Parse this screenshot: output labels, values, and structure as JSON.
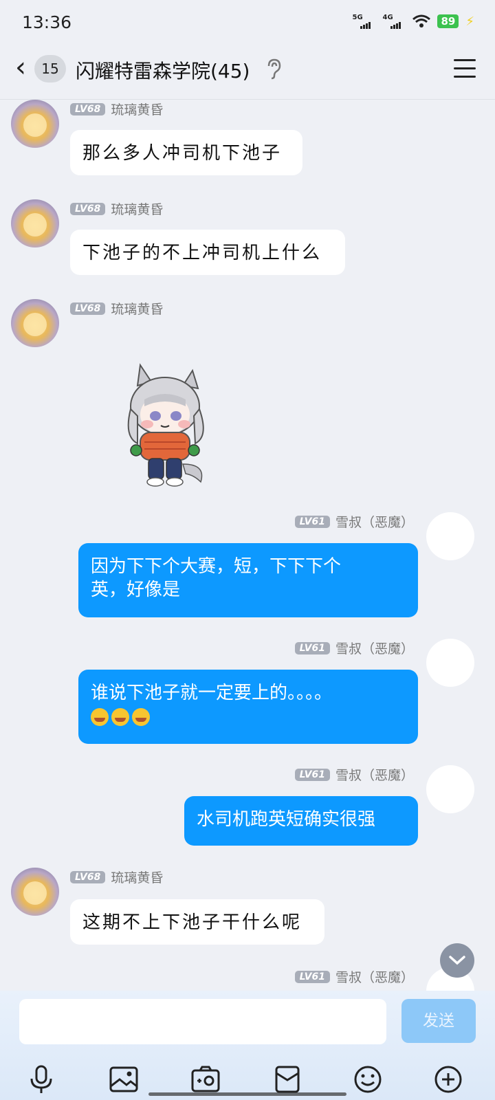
{
  "status_bar": {
    "time": "13:36",
    "signal_1": "5G",
    "signal_2": "4G",
    "battery": "89"
  },
  "header": {
    "unread_count": "15",
    "title": "闪耀特雷森学院(45)"
  },
  "messages": [
    {
      "side": "left",
      "level": "LV68",
      "sender": "琉璃黄昏",
      "text": "那么多人冲司机下池子"
    },
    {
      "side": "left",
      "level": "LV68",
      "sender": "琉璃黄昏",
      "text": "下池子的不上冲司机上什么"
    },
    {
      "side": "left",
      "level": "LV68",
      "sender": "琉璃黄昏",
      "sticker": "chibi-horse-girl-sticker"
    },
    {
      "side": "right",
      "level": "LV61",
      "sender": "雪叔（恶魔）",
      "line1": "因为下下个大赛，短，下下下个",
      "line2": "英，好像是"
    },
    {
      "side": "right",
      "level": "LV61",
      "sender": "雪叔（恶魔）",
      "text": "谁说下池子就一定要上的。。。。",
      "emojis": [
        "laugh-cry-emoji",
        "laugh-cry-emoji",
        "laugh-cry-emoji"
      ]
    },
    {
      "side": "right",
      "level": "LV61",
      "sender": "雪叔（恶魔）",
      "text": "水司机跑英短确实很强"
    },
    {
      "side": "left",
      "level": "LV68",
      "sender": "琉璃黄昏",
      "text": "这期不上下池子干什么呢"
    },
    {
      "side": "right",
      "level": "LV61",
      "sender": "雪叔（恶魔）"
    }
  ],
  "input": {
    "value": "",
    "send_label": "发送"
  },
  "toolbar": [
    "microphone-icon",
    "image-icon",
    "camera-icon",
    "red-packet-icon",
    "emoji-icon",
    "plus-icon"
  ],
  "colors": {
    "bubble_self": "#0d99ff",
    "send_button": "#8dc8f8",
    "background": "#eef0f5"
  }
}
